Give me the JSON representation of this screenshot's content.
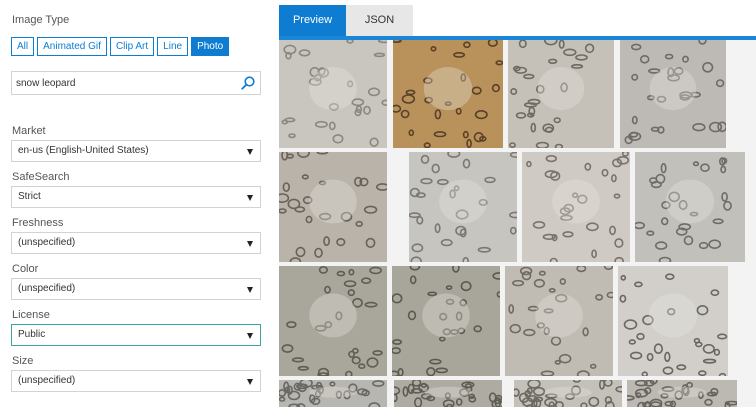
{
  "filters": {
    "image_type": {
      "label": "Image Type",
      "options": [
        "All",
        "Animated Gif",
        "Clip Art",
        "Line",
        "Photo"
      ],
      "selected": "Photo"
    },
    "search": {
      "value": "snow leopard",
      "placeholder": ""
    },
    "market": {
      "label": "Market",
      "value": "en-us (English-United States)"
    },
    "safesearch": {
      "label": "SafeSearch",
      "value": "Strict"
    },
    "freshness": {
      "label": "Freshness",
      "value": "(unspecified)"
    },
    "color": {
      "label": "Color",
      "value": "(unspecified)"
    },
    "license": {
      "label": "License",
      "value": "Public"
    },
    "size": {
      "label": "Size",
      "value": "(unspecified)"
    }
  },
  "tabs": [
    {
      "label": "Preview",
      "active": true
    },
    {
      "label": "JSON",
      "active": false
    }
  ],
  "results": {
    "subject": "snow leopard",
    "rows": 4,
    "thumbnail_count": 16
  },
  "colors": {
    "accent": "#0e7dd1",
    "tab_active_bg": "#0e7dd1",
    "tab_inactive_bg": "#e7e7e7",
    "select_highlight": "#3aa6a4"
  },
  "icons": {
    "search": "search-icon",
    "dropdown": "chevron-down-icon"
  }
}
